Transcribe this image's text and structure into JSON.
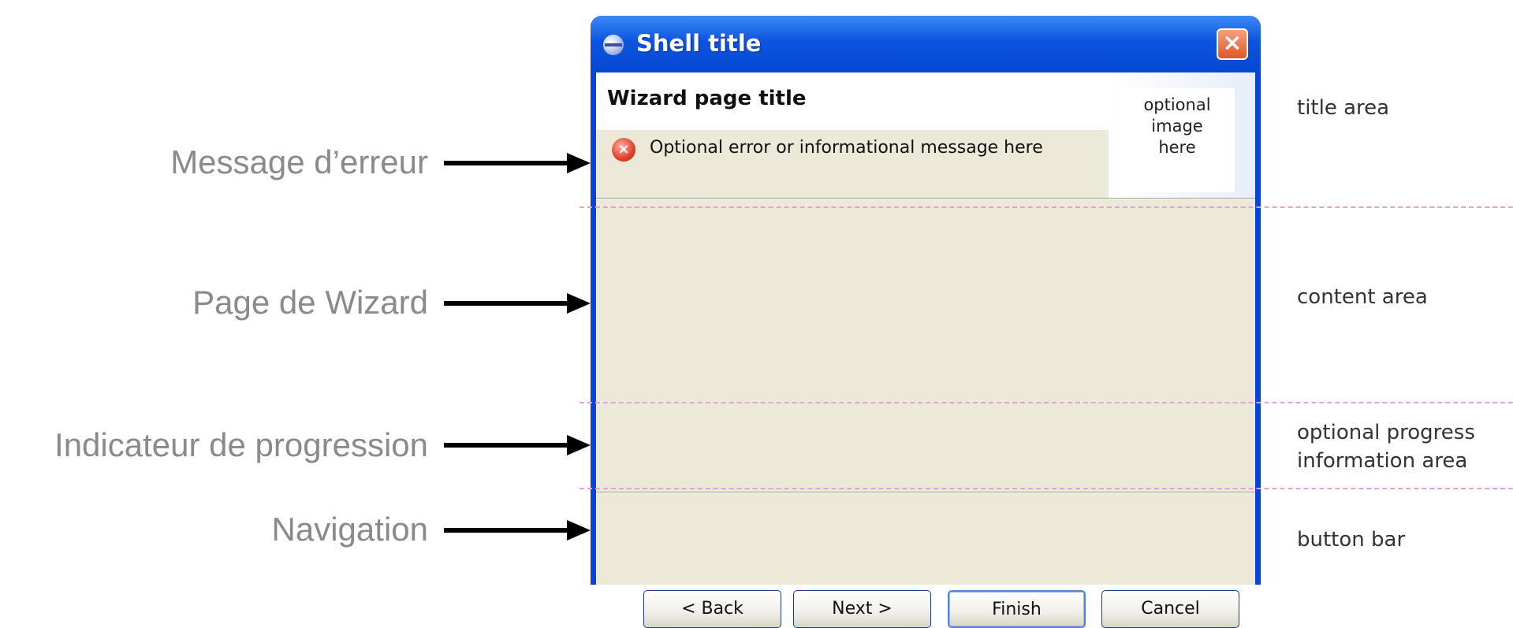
{
  "annotations_left": [
    "Message d’erreur",
    "Page de Wizard",
    "Indicateur de progression",
    "Navigation"
  ],
  "annotations_right": [
    "title area",
    "content area",
    "optional progress",
    "information area",
    "button bar"
  ],
  "window": {
    "title": "Shell title",
    "close_label": "×",
    "page_title": "Wizard page title",
    "message": "Optional error or informational message here",
    "image_line1": "optional",
    "image_line2": "image",
    "image_line3": "here"
  },
  "buttons": {
    "back": "< Back",
    "next": "Next >",
    "finish": "Finish",
    "cancel": "Cancel"
  },
  "colors": {
    "titlebar": "#0d54e1",
    "dialog_bg": "#ece9d8",
    "guide_dash": "#e59ee0",
    "annotation_text": "#8a8a8a"
  },
  "icons": [
    "app-icon",
    "close-icon",
    "error-icon",
    "arrow-icon"
  ]
}
